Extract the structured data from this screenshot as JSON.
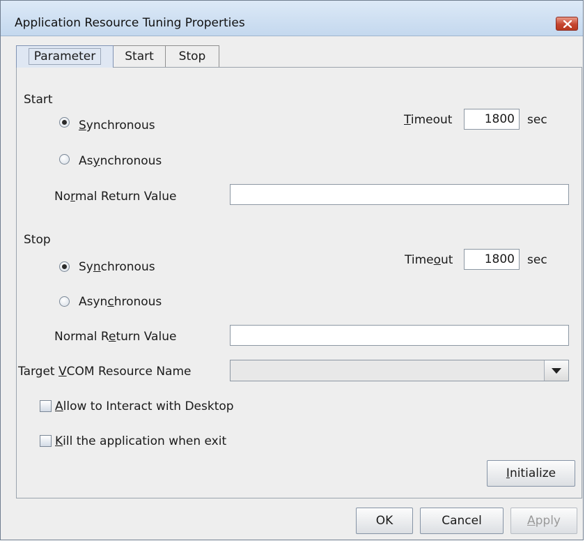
{
  "window": {
    "title": "Application Resource Tuning Properties",
    "close_icon": "close-icon"
  },
  "tabs": [
    {
      "label": "Parameter",
      "selected": true
    },
    {
      "label": "Start",
      "selected": false
    },
    {
      "label": "Stop",
      "selected": false
    }
  ],
  "start_section": {
    "heading": "Start",
    "sync_label_mnemonic": "S",
    "sync_label_rest": "ynchronous",
    "async_label_pre": "As",
    "async_label_mnemonic": "y",
    "async_label_rest": "nchronous",
    "mode": "Synchronous",
    "timeout_label_mnemonic": "T",
    "timeout_label_rest": "imeout",
    "timeout_value": "1800",
    "timeout_unit": "sec",
    "normal_return_label_pre": "No",
    "normal_return_label_mnemonic": "r",
    "normal_return_label_rest": "mal Return Value",
    "normal_return_value": ""
  },
  "stop_section": {
    "heading": "Stop",
    "sync_label_pre": "Sy",
    "sync_label_mnemonic": "n",
    "sync_label_rest": "chronous",
    "async_label_pre": "Asyn",
    "async_label_mnemonic": "c",
    "async_label_rest": "hronous",
    "mode": "Synchronous",
    "timeout_label_pre": "Time",
    "timeout_label_mnemonic": "o",
    "timeout_label_rest": "ut",
    "timeout_value": "1800",
    "timeout_unit": "sec",
    "normal_return_label_pre": "Normal R",
    "normal_return_label_mnemonic": "e",
    "normal_return_label_rest": "turn Value",
    "normal_return_value": ""
  },
  "target_vcom": {
    "label_pre": "Target ",
    "label_mnemonic": "V",
    "label_rest": "COM Resource Name",
    "value": ""
  },
  "options": {
    "allow_interact_mnemonic": "A",
    "allow_interact_rest": "llow to Interact with Desktop",
    "allow_interact_checked": false,
    "kill_app_mnemonic": "K",
    "kill_app_rest": "ill the application when exit",
    "kill_app_checked": false
  },
  "buttons": {
    "initialize_mnemonic": "I",
    "initialize_rest": "nitialize",
    "ok": "OK",
    "cancel": "Cancel",
    "apply_mnemonic": "A",
    "apply_rest": "pply"
  }
}
